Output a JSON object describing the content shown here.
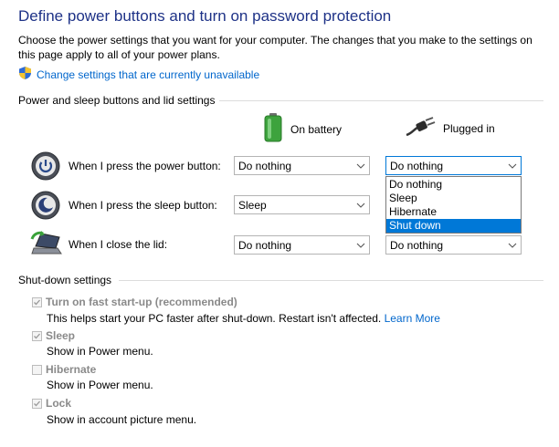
{
  "page": {
    "title": "Define power buttons and turn on password protection",
    "intro": "Choose the power settings that you want for your computer. The changes that you make to the settings on this page apply to all of your power plans.",
    "change_link": "Change settings that are currently unavailable"
  },
  "power_section": {
    "title": "Power and sleep buttons and lid settings",
    "col_battery": "On battery",
    "col_plugged": "Plugged in",
    "rows": [
      {
        "label": "When I press the power button:",
        "battery": "Do nothing",
        "plugged": "Do nothing",
        "icon": "power-button-icon"
      },
      {
        "label": "When I press the sleep button:",
        "battery": "Sleep",
        "plugged": "",
        "icon": "sleep-button-icon"
      },
      {
        "label": "When I close the lid:",
        "battery": "Do nothing",
        "plugged": "Do nothing",
        "icon": "laptop-lid-icon"
      }
    ],
    "dropdown_options": [
      "Do nothing",
      "Sleep",
      "Hibernate",
      "Shut down"
    ],
    "highlighted_option": "Shut down"
  },
  "shutdown_section": {
    "title": "Shut-down settings",
    "items": [
      {
        "label": "Turn on fast start-up (recommended)",
        "desc": "This helps start your PC faster after shut-down. Restart isn't affected.",
        "link": "Learn More",
        "checked": true
      },
      {
        "label": "Sleep",
        "desc": "Show in Power menu.",
        "checked": true
      },
      {
        "label": "Hibernate",
        "desc": "Show in Power menu.",
        "checked": false
      },
      {
        "label": "Lock",
        "desc": "Show in account picture menu.",
        "checked": true
      }
    ]
  },
  "colors": {
    "title": "#1e3287",
    "link": "#0066cc",
    "selection": "#0078d7",
    "disabled_text": "#8a8a8a"
  }
}
